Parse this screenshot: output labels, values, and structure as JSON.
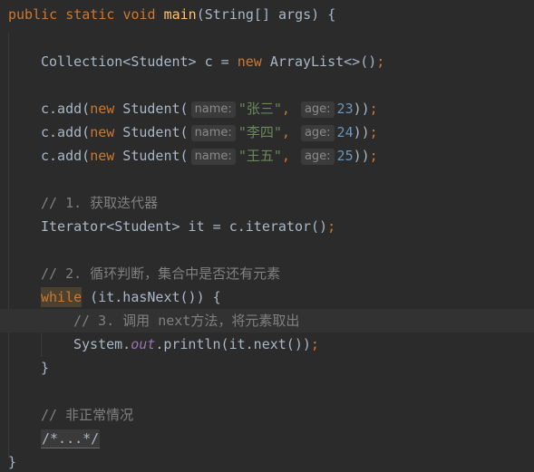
{
  "lines": {
    "l1": {
      "kw_public": "public",
      "kw_static": "static",
      "kw_void": "void",
      "fn_main": "main",
      "params": "(String[] args) {"
    },
    "l3": {
      "type": "Collection<Student> c = ",
      "kw_new": "new",
      "ctor": " ArrayList<>()",
      "semi": ";"
    },
    "adds": [
      {
        "prefix": "c.add(",
        "kw_new": "new",
        "ctor": " Student(",
        "hint_name": "name:",
        "name": "\"张三\"",
        "comma": ",",
        "hint_age": "age:",
        "age": "23",
        "suffix": "))",
        "semi": ";"
      },
      {
        "prefix": "c.add(",
        "kw_new": "new",
        "ctor": " Student(",
        "hint_name": "name:",
        "name": "\"李四\"",
        "comma": ",",
        "hint_age": "age:",
        "age": "24",
        "suffix": "))",
        "semi": ";"
      },
      {
        "prefix": "c.add(",
        "kw_new": "new",
        "ctor": " Student(",
        "hint_name": "name:",
        "name": "\"王五\"",
        "comma": ",",
        "hint_age": "age:",
        "age": "25",
        "suffix": "))",
        "semi": ";"
      }
    ],
    "c1": "// 1. 获取迭代器",
    "l10": {
      "text": "Iterator<Student> it = c.iterator()",
      "semi": ";"
    },
    "c2": "// 2. 循环判断，集合中是否还有元素",
    "l13": {
      "kw_while": "while",
      "text": " (it.hasNext()) {"
    },
    "c3": "// 3. 调用 next方法，将元素取出",
    "l15": {
      "pre": "System.",
      "field": "out",
      "post": ".println(it.next())",
      "semi": ";"
    },
    "close_inner": "}",
    "c4": "// 非正常情况",
    "folded": "/*...*/",
    "close_outer": "}"
  }
}
